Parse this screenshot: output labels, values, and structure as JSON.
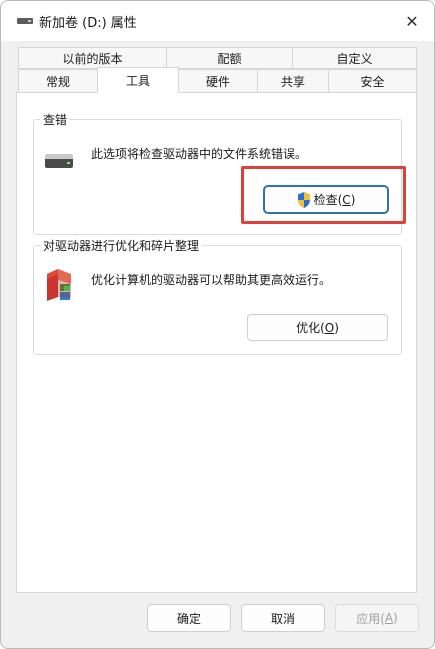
{
  "window": {
    "title": "新加卷 (D:) 属性",
    "close_label": "✕"
  },
  "tabs": {
    "row1": [
      "以前的版本",
      "配额",
      "自定义"
    ],
    "row2": [
      "常规",
      "工具",
      "硬件",
      "共享",
      "安全"
    ],
    "active": "工具"
  },
  "check_group": {
    "title": "查错",
    "description": "此选项将检查驱动器中的文件系统错误。",
    "button_text": "检查(",
    "button_mnemonic": "C",
    "button_suffix": ")"
  },
  "optimize_group": {
    "title": "对驱动器进行优化和碎片整理",
    "description": "优化计算机的驱动器可以帮助其更高效运行。",
    "button_text": "优化(",
    "button_mnemonic": "O",
    "button_suffix": ")"
  },
  "footer": {
    "ok": "确定",
    "cancel": "取消",
    "apply_text": "应用(",
    "apply_mnemonic": "A",
    "apply_suffix": ")"
  },
  "icons": {
    "title": "drive-icon",
    "check": "drive-icon",
    "optimize": "defrag-icon",
    "check_button": "uac-shield-icon"
  },
  "colors": {
    "highlight": "#e0403a",
    "focus_border": "#2f6fb7"
  }
}
